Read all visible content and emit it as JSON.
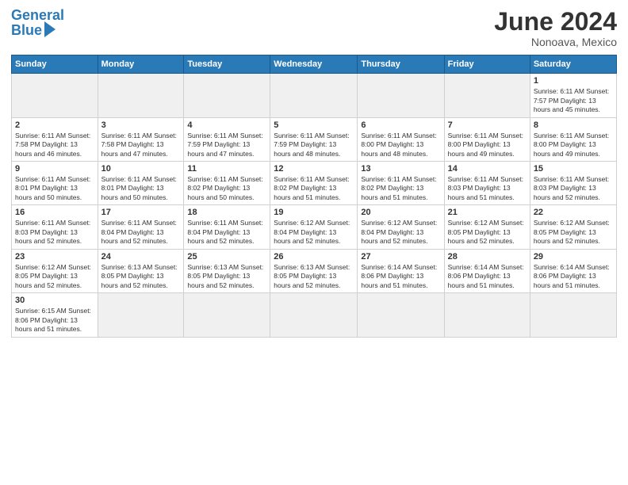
{
  "header": {
    "logo_general": "General",
    "logo_blue": "Blue",
    "title": "June 2024",
    "location": "Nonoava, Mexico"
  },
  "days_of_week": [
    "Sunday",
    "Monday",
    "Tuesday",
    "Wednesday",
    "Thursday",
    "Friday",
    "Saturday"
  ],
  "weeks": [
    [
      {
        "num": "",
        "info": "",
        "empty": true
      },
      {
        "num": "",
        "info": "",
        "empty": true
      },
      {
        "num": "",
        "info": "",
        "empty": true
      },
      {
        "num": "",
        "info": "",
        "empty": true
      },
      {
        "num": "",
        "info": "",
        "empty": true
      },
      {
        "num": "",
        "info": "",
        "empty": true
      },
      {
        "num": "1",
        "info": "Sunrise: 6:11 AM\nSunset: 7:57 PM\nDaylight: 13 hours\nand 45 minutes."
      }
    ],
    [
      {
        "num": "2",
        "info": "Sunrise: 6:11 AM\nSunset: 7:58 PM\nDaylight: 13 hours\nand 46 minutes."
      },
      {
        "num": "3",
        "info": "Sunrise: 6:11 AM\nSunset: 7:58 PM\nDaylight: 13 hours\nand 47 minutes."
      },
      {
        "num": "4",
        "info": "Sunrise: 6:11 AM\nSunset: 7:59 PM\nDaylight: 13 hours\nand 47 minutes."
      },
      {
        "num": "5",
        "info": "Sunrise: 6:11 AM\nSunset: 7:59 PM\nDaylight: 13 hours\nand 48 minutes."
      },
      {
        "num": "6",
        "info": "Sunrise: 6:11 AM\nSunset: 8:00 PM\nDaylight: 13 hours\nand 48 minutes."
      },
      {
        "num": "7",
        "info": "Sunrise: 6:11 AM\nSunset: 8:00 PM\nDaylight: 13 hours\nand 49 minutes."
      },
      {
        "num": "8",
        "info": "Sunrise: 6:11 AM\nSunset: 8:00 PM\nDaylight: 13 hours\nand 49 minutes."
      }
    ],
    [
      {
        "num": "9",
        "info": "Sunrise: 6:11 AM\nSunset: 8:01 PM\nDaylight: 13 hours\nand 50 minutes."
      },
      {
        "num": "10",
        "info": "Sunrise: 6:11 AM\nSunset: 8:01 PM\nDaylight: 13 hours\nand 50 minutes."
      },
      {
        "num": "11",
        "info": "Sunrise: 6:11 AM\nSunset: 8:02 PM\nDaylight: 13 hours\nand 50 minutes."
      },
      {
        "num": "12",
        "info": "Sunrise: 6:11 AM\nSunset: 8:02 PM\nDaylight: 13 hours\nand 51 minutes."
      },
      {
        "num": "13",
        "info": "Sunrise: 6:11 AM\nSunset: 8:02 PM\nDaylight: 13 hours\nand 51 minutes."
      },
      {
        "num": "14",
        "info": "Sunrise: 6:11 AM\nSunset: 8:03 PM\nDaylight: 13 hours\nand 51 minutes."
      },
      {
        "num": "15",
        "info": "Sunrise: 6:11 AM\nSunset: 8:03 PM\nDaylight: 13 hours\nand 52 minutes."
      }
    ],
    [
      {
        "num": "16",
        "info": "Sunrise: 6:11 AM\nSunset: 8:03 PM\nDaylight: 13 hours\nand 52 minutes."
      },
      {
        "num": "17",
        "info": "Sunrise: 6:11 AM\nSunset: 8:04 PM\nDaylight: 13 hours\nand 52 minutes."
      },
      {
        "num": "18",
        "info": "Sunrise: 6:11 AM\nSunset: 8:04 PM\nDaylight: 13 hours\nand 52 minutes."
      },
      {
        "num": "19",
        "info": "Sunrise: 6:12 AM\nSunset: 8:04 PM\nDaylight: 13 hours\nand 52 minutes."
      },
      {
        "num": "20",
        "info": "Sunrise: 6:12 AM\nSunset: 8:04 PM\nDaylight: 13 hours\nand 52 minutes."
      },
      {
        "num": "21",
        "info": "Sunrise: 6:12 AM\nSunset: 8:05 PM\nDaylight: 13 hours\nand 52 minutes."
      },
      {
        "num": "22",
        "info": "Sunrise: 6:12 AM\nSunset: 8:05 PM\nDaylight: 13 hours\nand 52 minutes."
      }
    ],
    [
      {
        "num": "23",
        "info": "Sunrise: 6:12 AM\nSunset: 8:05 PM\nDaylight: 13 hours\nand 52 minutes."
      },
      {
        "num": "24",
        "info": "Sunrise: 6:13 AM\nSunset: 8:05 PM\nDaylight: 13 hours\nand 52 minutes."
      },
      {
        "num": "25",
        "info": "Sunrise: 6:13 AM\nSunset: 8:05 PM\nDaylight: 13 hours\nand 52 minutes."
      },
      {
        "num": "26",
        "info": "Sunrise: 6:13 AM\nSunset: 8:05 PM\nDaylight: 13 hours\nand 52 minutes."
      },
      {
        "num": "27",
        "info": "Sunrise: 6:14 AM\nSunset: 8:06 PM\nDaylight: 13 hours\nand 51 minutes."
      },
      {
        "num": "28",
        "info": "Sunrise: 6:14 AM\nSunset: 8:06 PM\nDaylight: 13 hours\nand 51 minutes."
      },
      {
        "num": "29",
        "info": "Sunrise: 6:14 AM\nSunset: 8:06 PM\nDaylight: 13 hours\nand 51 minutes."
      }
    ],
    [
      {
        "num": "30",
        "info": "Sunrise: 6:15 AM\nSunset: 8:06 PM\nDaylight: 13 hours\nand 51 minutes."
      },
      {
        "num": "",
        "info": "",
        "empty": true
      },
      {
        "num": "",
        "info": "",
        "empty": true
      },
      {
        "num": "",
        "info": "",
        "empty": true
      },
      {
        "num": "",
        "info": "",
        "empty": true
      },
      {
        "num": "",
        "info": "",
        "empty": true
      },
      {
        "num": "",
        "info": "",
        "empty": true
      }
    ]
  ]
}
